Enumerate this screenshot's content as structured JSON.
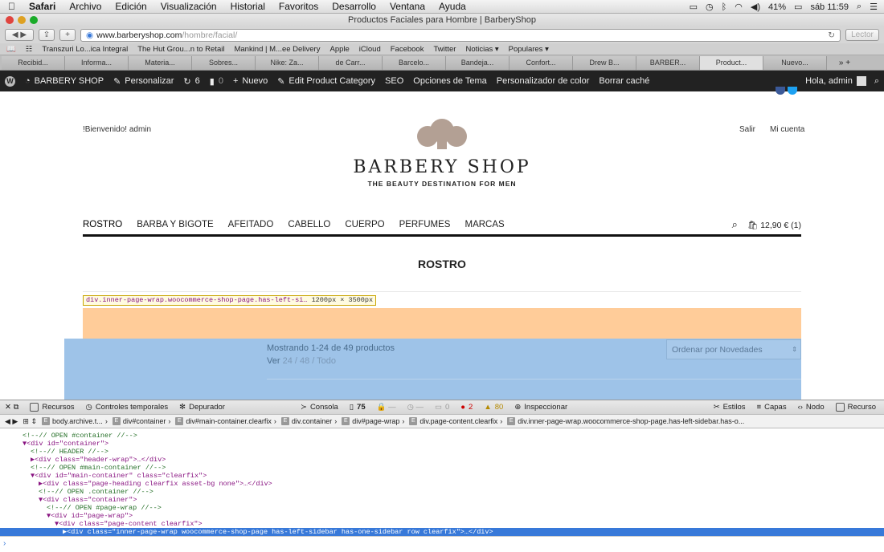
{
  "menubar": {
    "apple": "",
    "items": [
      "Safari",
      "Archivo",
      "Edición",
      "Visualización",
      "Historial",
      "Favoritos",
      "Desarrollo",
      "Ventana",
      "Ayuda"
    ],
    "battery": "41%",
    "clock": "sáb 11:59"
  },
  "window": {
    "title": "Productos Faciales para Hombre | BarberyShop"
  },
  "toolbar": {
    "url_host": "www.barberyshop.com",
    "url_path": "/hombre/facial/",
    "reader": "Lector"
  },
  "bookmarks": [
    "Transzuri Lo...ica Integral",
    "The Hut Grou...n to Retail",
    "Mankind | M...ee Delivery",
    "Apple",
    "iCloud",
    "Facebook",
    "Twitter",
    "Noticias ▾",
    "Populares ▾"
  ],
  "tabs": [
    "Recibid...",
    "Informa...",
    "Materia...",
    "Sobres...",
    "Nike: Za...",
    "de Carr...",
    "Barcelo...",
    "Bandeja...",
    "Confort...",
    "Drew B...",
    "BARBER...",
    "Product...",
    "Nuevo..."
  ],
  "adminbar": {
    "site": "BARBERY SHOP",
    "customize": "Personalizar",
    "updates": "6",
    "comments": "0",
    "new": "Nuevo",
    "edit": "Edit Product Category",
    "seo": "SEO",
    "theme_options": "Opciones de Tema",
    "color": "Personalizador de color",
    "cache": "Borrar caché",
    "greeting": "Hola, admin"
  },
  "site": {
    "welcome": "!Bienvenido! admin",
    "logout": "Salir",
    "account": "Mi cuenta",
    "logo": "BARBERY SHOP",
    "tagline": "THE BEAUTY DESTINATION FOR MEN",
    "nav": [
      "ROSTRO",
      "BARBA Y BIGOTE",
      "AFEITADO",
      "CABELLO",
      "CUERPO",
      "PERFUMES",
      "MARCAS"
    ],
    "cart": "12,90 € (1)",
    "page_title": "ROSTRO",
    "tooltip": {
      "selector": "div.inner-page-wrap.woocommerce-shop-page.has-left-si…",
      "size": "1200px × 3500px"
    },
    "count": "Mostrando 1-24 de 49 productos",
    "ver_label": "Ver",
    "ver_opts": "24 / 48 / Todo",
    "sort": "Ordenar por Novedades"
  },
  "inspector": {
    "tabs": [
      "Recursos",
      "Controles temporales",
      "Depurador",
      "Consola"
    ],
    "resources_count": "75",
    "errors": "2",
    "warnings": "80",
    "zero": "0",
    "inspect": "Inspeccionar",
    "right": [
      "Estilos",
      "Capas",
      "Nodo",
      "Recurso"
    ]
  },
  "breadcrumbs": [
    "body.archive.t...",
    "div#container",
    "div#main-container.clearfix",
    "div.container",
    "div#page-wrap",
    "div.page-content.clearfix",
    "div.inner-page-wrap.woocommerce-shop-page.has-left-sidebar.has-o..."
  ],
  "dom": [
    {
      "indent": 0,
      "text": "<!--// OPEN #container //-->",
      "cls": "cm"
    },
    {
      "indent": 0,
      "text": "▼<div id=\"container\">",
      "cls": "tag"
    },
    {
      "indent": 1,
      "text": "<!--// HEADER //-->",
      "cls": "cm"
    },
    {
      "indent": 1,
      "text": "▶<div class=\"header-wrap\">…</div>",
      "cls": "tag"
    },
    {
      "indent": 1,
      "text": "<!--// OPEN #main-container //-->",
      "cls": "cm"
    },
    {
      "indent": 1,
      "text": "▼<div id=\"main-container\" class=\"clearfix\">",
      "cls": "tag"
    },
    {
      "indent": 2,
      "text": "▶<div class=\"page-heading clearfix asset-bg none\">…</div>",
      "cls": "tag"
    },
    {
      "indent": 2,
      "text": "<!--// OPEN .container //-->",
      "cls": "cm"
    },
    {
      "indent": 2,
      "text": "▼<div class=\"container\">",
      "cls": "tag"
    },
    {
      "indent": 3,
      "text": "<!--// OPEN #page-wrap //-->",
      "cls": "cm"
    },
    {
      "indent": 3,
      "text": "▼<div id=\"page-wrap\">",
      "cls": "tag"
    },
    {
      "indent": 4,
      "text": "▼<div class=\"page-content clearfix\">",
      "cls": "tag"
    },
    {
      "indent": 5,
      "text": "▶<div class=\"inner-page-wrap woocommerce-shop-page has-left-sidebar has-one-sidebar row clearfix\">…</div>",
      "cls": "tag",
      "selected": true
    }
  ],
  "console": {
    "prompt": "›"
  }
}
